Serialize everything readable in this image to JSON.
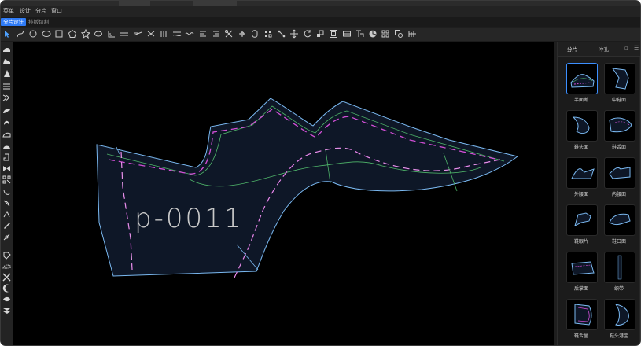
{
  "window": {
    "menu": [
      "菜单",
      "设计",
      "分片",
      "窗口"
    ]
  },
  "modes": [
    {
      "label": "分片设计",
      "active": true
    },
    {
      "label": "排版切割",
      "active": false
    }
  ],
  "toolbar": {
    "icons": [
      "pointer-arrow-icon",
      "bezier-curve-icon",
      "circle-icon",
      "ellipse-icon",
      "rectangle-icon",
      "pentagon-icon",
      "star-icon",
      "oval-icon",
      "ruler-angle-icon",
      "parallel-lines-icon",
      "offset-line-icon",
      "extend-line-icon",
      "split-icon",
      "wave-line-icon",
      "wavy-line-icon",
      "mirror-icon",
      "align-icon",
      "scissors-icon",
      "cut-icon",
      "loop-icon",
      "grid-select-icon",
      "node-icon",
      "move-icon",
      "rotate-icon",
      "scale-icon",
      "frame-icon",
      "panel-icon",
      "text-icon",
      "color-wheel-icon",
      "grid-icon",
      "zoom-select-icon",
      "measure-icon"
    ]
  },
  "left_tools": {
    "icons": [
      "shoe-toe-icon",
      "shoe-heel-icon",
      "triangle-icon",
      "stack-icon",
      "layers-icon",
      "shoe-side-icon",
      "half-moon-icon",
      "vamp-icon",
      "dome-icon",
      "boot-icon",
      "bowtie-icon",
      "qr-grid-icon",
      "hook-icon",
      "lace-icon",
      "angle-icon",
      "pen-icon",
      "chain-icon",
      "tag-icon",
      "shoe-outline-icon",
      "cross-icon",
      "crescent-icon",
      "fish-icon",
      "arrow-stack-icon"
    ]
  },
  "canvas": {
    "piece_label": "p-0011"
  },
  "right_panel": {
    "tabs": [
      "分片",
      "冲孔"
    ],
    "items": [
      {
        "label": "半面断",
        "selected": true
      },
      {
        "label": "中鞋面",
        "selected": false
      },
      {
        "label": "鞋头面",
        "selected": false
      },
      {
        "label": "鞋舌面",
        "selected": false
      },
      {
        "label": "外腰面",
        "selected": false
      },
      {
        "label": "内腰面",
        "selected": false
      },
      {
        "label": "鞋眼片",
        "selected": false
      },
      {
        "label": "鞋口面",
        "selected": false
      },
      {
        "label": "后掌面",
        "selected": false
      },
      {
        "label": "织带",
        "selected": false
      },
      {
        "label": "鞋舌里",
        "selected": false
      },
      {
        "label": "鞋头港宝",
        "selected": false
      }
    ]
  },
  "colors": {
    "accent": "#2f7bf5",
    "piece_fill": "#0e1727",
    "outline": "#7ab8f0",
    "seam_green": "#4fb66a",
    "stitch_magenta": "#d14fd6"
  }
}
